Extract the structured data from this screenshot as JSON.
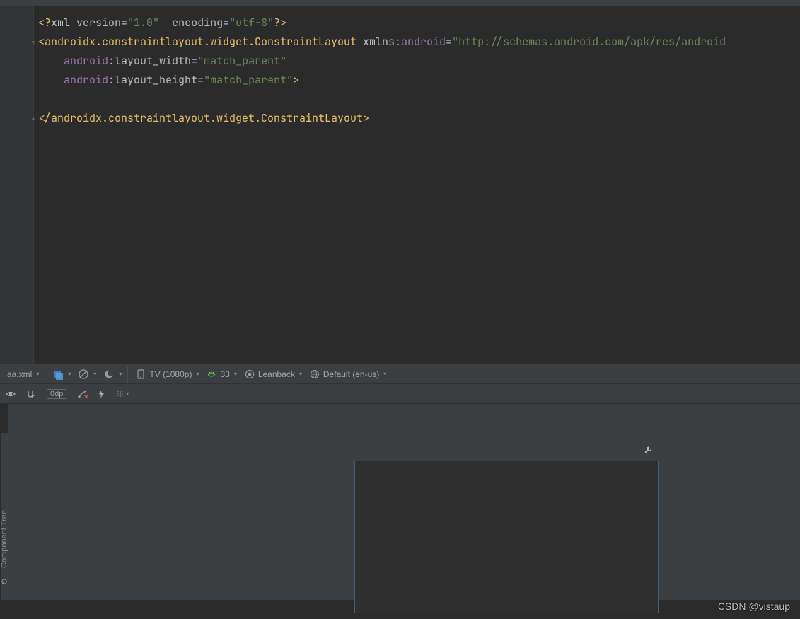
{
  "editor": {
    "lines": [
      [
        {
          "cls": "pi",
          "text": "<?"
        },
        {
          "cls": "attrname",
          "text": "xml version"
        },
        {
          "cls": "eq",
          "text": "="
        },
        {
          "cls": "str",
          "text": "\"1.0\""
        },
        {
          "cls": "attrname",
          "text": "  encoding"
        },
        {
          "cls": "eq",
          "text": "="
        },
        {
          "cls": "str",
          "text": "\"utf-8\""
        },
        {
          "cls": "pi",
          "text": "?>"
        }
      ],
      [
        {
          "cls": "tag",
          "text": "<androidx.constraintlayout.widget.ConstraintLayout "
        },
        {
          "cls": "attrname",
          "text": "xmlns:"
        },
        {
          "cls": "ns",
          "text": "android"
        },
        {
          "cls": "eq",
          "text": "="
        },
        {
          "cls": "str",
          "text": "\"http://schemas.android.com/apk/res/android"
        }
      ],
      [
        {
          "cls": "attrname",
          "text": "    "
        },
        {
          "cls": "ns",
          "text": "android"
        },
        {
          "cls": "attrname",
          "text": ":layout_width"
        },
        {
          "cls": "eq",
          "text": "="
        },
        {
          "cls": "str",
          "text": "\"match_parent\""
        }
      ],
      [
        {
          "cls": "attrname",
          "text": "    "
        },
        {
          "cls": "ns",
          "text": "android"
        },
        {
          "cls": "attrname",
          "text": ":layout_height"
        },
        {
          "cls": "eq",
          "text": "="
        },
        {
          "cls": "str",
          "text": "\"match_parent\""
        },
        {
          "cls": "tag",
          "text": ">"
        }
      ],
      [],
      [
        {
          "cls": "tag",
          "text": "</androidx.constraintlayout.widget.ConstraintLayout>"
        }
      ]
    ]
  },
  "designbar": {
    "file_dropdown": "aa.xml",
    "device": "TV (1080p)",
    "api": "33",
    "theme": "Leanback",
    "locale": "Default (en-us)"
  },
  "designbar2": {
    "dp": "0dp"
  },
  "sidebar": {
    "component_tree": "Component Tree"
  },
  "watermark": {
    "text": "CSDN @vistaup"
  }
}
